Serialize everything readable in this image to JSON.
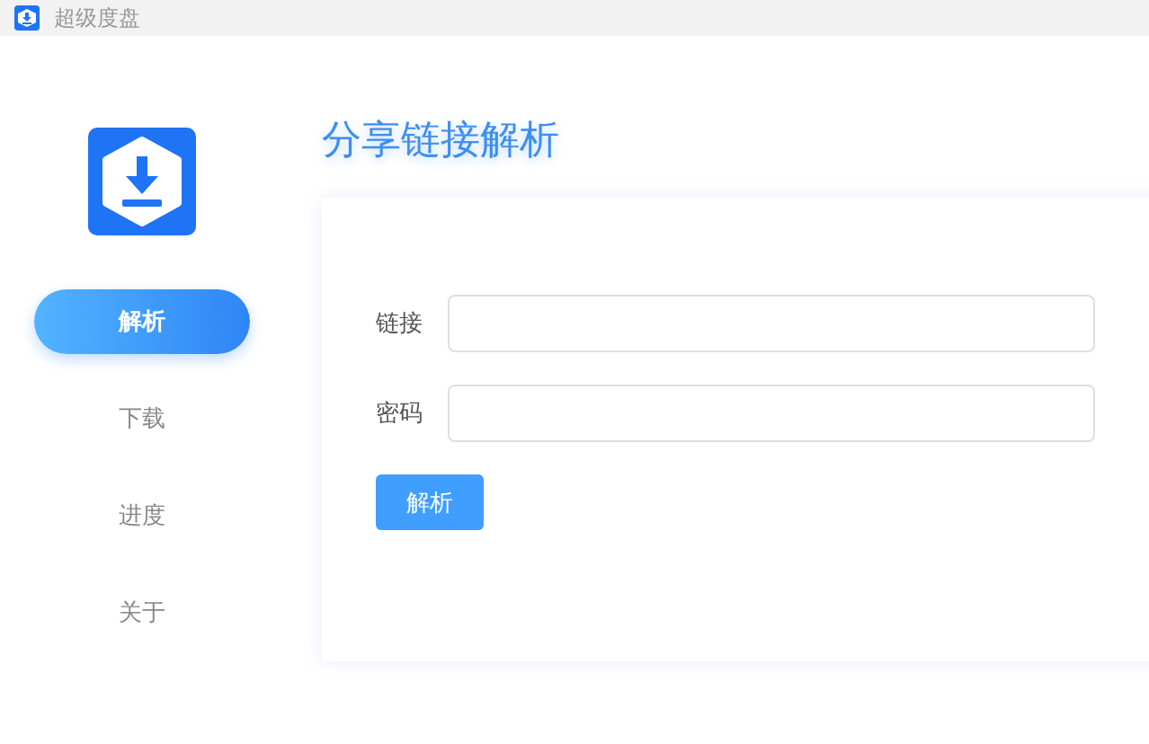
{
  "window": {
    "title": "超级度盘"
  },
  "nav": [
    {
      "label": "解析",
      "selected": true
    },
    {
      "label": "下载",
      "selected": false
    },
    {
      "label": "进度",
      "selected": false
    },
    {
      "label": "关于",
      "selected": false
    }
  ],
  "page_title": "分享链接解析",
  "form": {
    "fields": [
      {
        "label": "链接"
      },
      {
        "label": "密码"
      }
    ],
    "submit": "解析"
  }
}
